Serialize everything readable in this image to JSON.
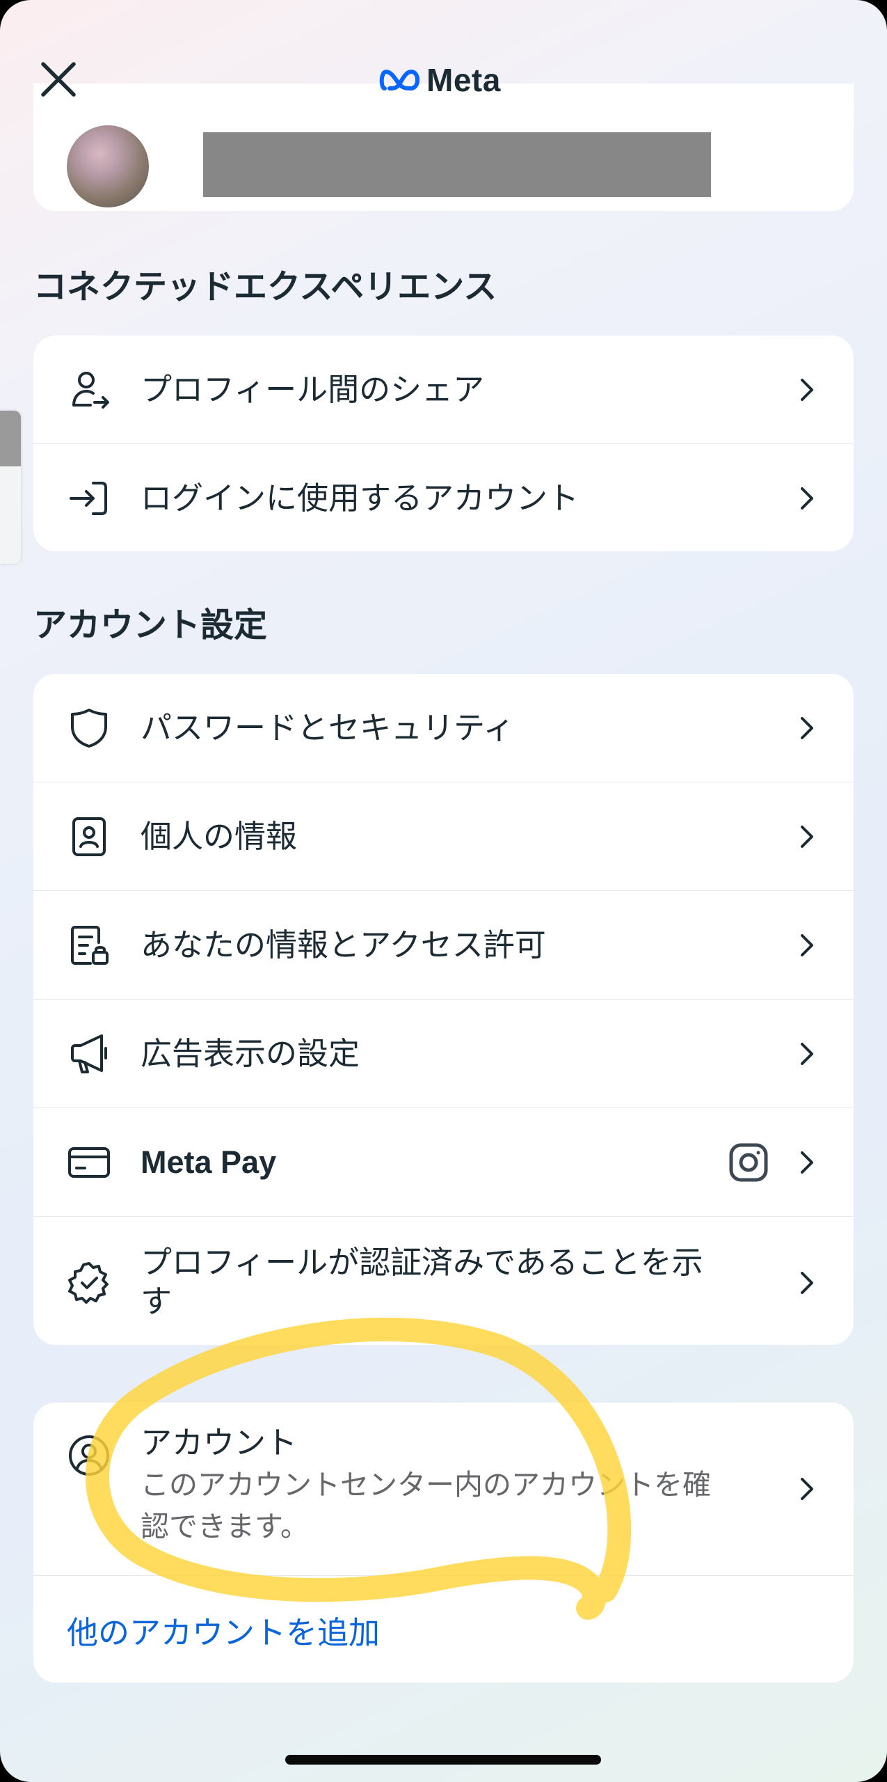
{
  "header": {
    "brand": "Meta",
    "close_icon": "close-icon"
  },
  "sections": {
    "connected": {
      "title": "コネクテッドエクスペリエンス",
      "items": [
        {
          "label": "プロフィール間のシェア",
          "icon": "profile-share-icon"
        },
        {
          "label": "ログインに使用するアカウント",
          "icon": "login-arrow-icon"
        }
      ]
    },
    "account_settings": {
      "title": "アカウント設定",
      "items": [
        {
          "label": "パスワードとセキュリティ",
          "icon": "shield-icon"
        },
        {
          "label": "個人の情報",
          "icon": "id-card-icon"
        },
        {
          "label": "あなたの情報とアクセス許可",
          "icon": "document-lock-icon"
        },
        {
          "label": "広告表示の設定",
          "icon": "megaphone-icon"
        },
        {
          "label": "Meta Pay",
          "icon": "credit-card-icon",
          "badge_icon": "instagram-icon"
        },
        {
          "label_line1": "プロフィールが認証済みであることを示",
          "label_line2": "す",
          "icon": "verified-badge-icon"
        }
      ]
    },
    "accounts": {
      "title": "アカウント",
      "description_line1": "このアカウントセンター内のアカウントを確",
      "description_line2": "認できます。",
      "icon": "user-circle-icon",
      "add_account_label": "他のアカウントを追加"
    }
  },
  "colors": {
    "text_primary": "#1c2b33",
    "text_secondary": "#65676b",
    "link_blue": "#0a66d8",
    "highlight_yellow": "#ffd43b"
  }
}
